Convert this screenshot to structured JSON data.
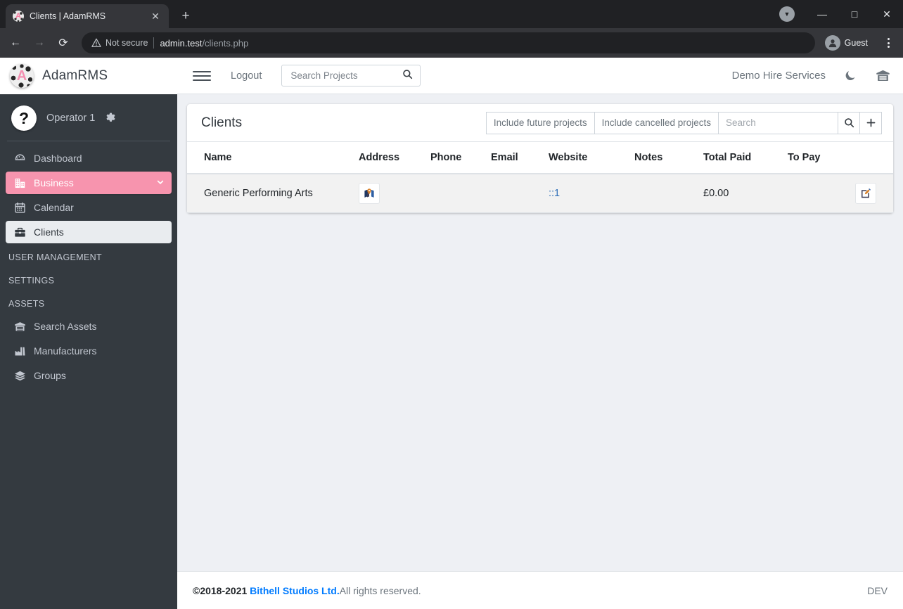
{
  "browser": {
    "tab": {
      "title": "Clients | AdamRMS",
      "favicon_letter": "A",
      "close_label": "✕"
    },
    "new_tab_label": "+",
    "window_controls": {
      "minimize": "—",
      "maximize": "□",
      "close": "✕"
    },
    "nav": {
      "back": "←",
      "forward": "→",
      "reload": "⟳"
    },
    "omnibox": {
      "security_text": "Not secure",
      "url_host": "admin.test",
      "url_path": "/clients.php"
    },
    "profile_label": "Guest"
  },
  "sidebar": {
    "brand": {
      "name": "AdamRMS",
      "logo_letter": "A"
    },
    "user": {
      "name": "Operator 1",
      "avatar_glyph": "?"
    },
    "items": [
      {
        "label": "Dashboard",
        "icon": "dashboard-icon",
        "state": "normal"
      },
      {
        "label": "Business",
        "icon": "building-icon",
        "state": "active",
        "chevron": "⌄"
      },
      {
        "label": "Calendar",
        "icon": "calendar-icon",
        "state": "normal"
      },
      {
        "label": "Clients",
        "icon": "briefcase-icon",
        "state": "current"
      }
    ],
    "sections": [
      {
        "header": "USER MANAGEMENT",
        "items": []
      },
      {
        "header": "SETTINGS",
        "items": []
      },
      {
        "header": "ASSETS",
        "items": [
          {
            "label": "Search Assets",
            "icon": "warehouse-icon"
          },
          {
            "label": "Manufacturers",
            "icon": "factory-icon"
          },
          {
            "label": "Groups",
            "icon": "layers-icon"
          }
        ]
      }
    ]
  },
  "navbar": {
    "menu_toggle": "hamburger-icon",
    "logout_label": "Logout",
    "search": {
      "value": "",
      "placeholder": "Search Projects"
    },
    "org_label": "Demo Hire Services",
    "dark_mode_icon": "moon-icon",
    "warehouse_icon": "warehouse-icon"
  },
  "card": {
    "title": "Clients",
    "buttons": [
      {
        "label": "Include future projects",
        "name": "include-future-projects-button"
      },
      {
        "label": "Include cancelled projects",
        "name": "include-cancelled-projects-button"
      }
    ],
    "search": {
      "value": "",
      "placeholder": "Search"
    },
    "search_icon": "search-icon",
    "add_icon": "plus-icon"
  },
  "table": {
    "columns": [
      "Name",
      "Address",
      "Phone",
      "Email",
      "Website",
      "Notes",
      "Total Paid",
      "To Pay"
    ],
    "rows": [
      {
        "name": "Generic Performing Arts",
        "address_icon": "map-pin-icon",
        "phone": "",
        "email": "",
        "website": "::1",
        "notes": "",
        "total_paid": "£0.00",
        "to_pay": "",
        "edit_icon": "edit-icon"
      }
    ]
  },
  "footer": {
    "copyright": "©2018-2021",
    "company": "Bithell Studios Ltd.",
    "rights": " All rights reserved.",
    "environment": "DEV"
  },
  "colors": {
    "accent_pink": "#f794ae",
    "sidebar_dark": "#343a40",
    "link_blue": "#007bff",
    "content_bg": "#eef0f4"
  }
}
